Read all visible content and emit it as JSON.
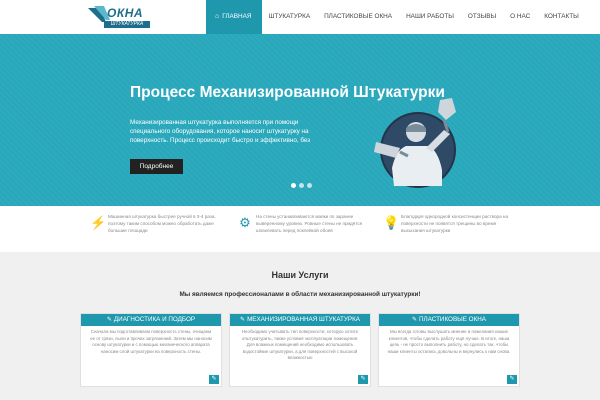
{
  "header": {
    "logo_text": "ОКНА",
    "logo_sub": "ШТУКАТУРКА",
    "nav": [
      {
        "label": "ГЛАВНАЯ",
        "icon": "home-icon",
        "active": true
      },
      {
        "label": "ШТУКАТУРКА"
      },
      {
        "label": "ПЛАСТИКОВЫЕ ОКНА"
      },
      {
        "label": "НАШИ РАБОТЫ"
      },
      {
        "label": "ОТЗЫВЫ"
      },
      {
        "label": "О НАС"
      },
      {
        "label": "КОНТАКТЫ"
      }
    ]
  },
  "hero": {
    "title": "Процесс Механизированной Штукатурки",
    "text": "Механизированная штукатурка выполняется при помощи специального оборудования, которое наносит штукатурку на поверхность. Процесс происходит быстро и эффективно, без",
    "button": "Подробнее",
    "slides": 3,
    "active_slide": 1
  },
  "features": [
    {
      "icon": "lightning-icon",
      "text": "Машинная штукатурка быстрее ручной в 3-4 раза, поэтому таким способом можно обработать даже большие площади"
    },
    {
      "icon": "gear-icon",
      "text": "На стены устанавливаются маяки по заранее выверенному уровню. Ровные стены не придётся шпаклевать перед поклейкой обоев"
    },
    {
      "icon": "lightbulb-icon",
      "text": "Благодаря однородной консистенции раствора на поверхности не появятся трещины во время высыхания штукатурки"
    }
  ],
  "services": {
    "title": "Наши Услуги",
    "subtitle": "Мы являемся профессионалами в области механизированной штукатурки!",
    "cards": [
      {
        "title": "ДИАГНОСТИКА И ПОДБОР",
        "text": "Сначала мы подготавливаем поверхность стены, очищаем ее от грязи, пыли и прочих загрязнений. Затем мы наносим основу штукатурки и с помощью механического аппарата наносим слой штукатурки на поверхность стены."
      },
      {
        "title": "МЕХАНИЗИРОВАННАЯ ШТУКАТУРКА",
        "text": "Необходимо учитывать тип поверхности, которую хотите отштукатурить, также условия эксплуатации помещения. Для влажных помещений необходимо использовать водостойкие штукатурки, а для поверхностей с высокой влажностью"
      },
      {
        "title": "ПЛАСТИКОВЫЕ ОКНА",
        "text": "Мы всегда готовы выслушать мнение и пожелания наших клиентов, чтобы сделать работу ещё лучше. В итоге, наша цель - не просто выполнить работу, но сделать так, чтобы наши клиенты остались довольны и вернулись к нам снова."
      }
    ]
  },
  "colors": {
    "accent": "#1f97ad",
    "hero_bg": "#2aa8bb",
    "button_dark": "#222222"
  }
}
